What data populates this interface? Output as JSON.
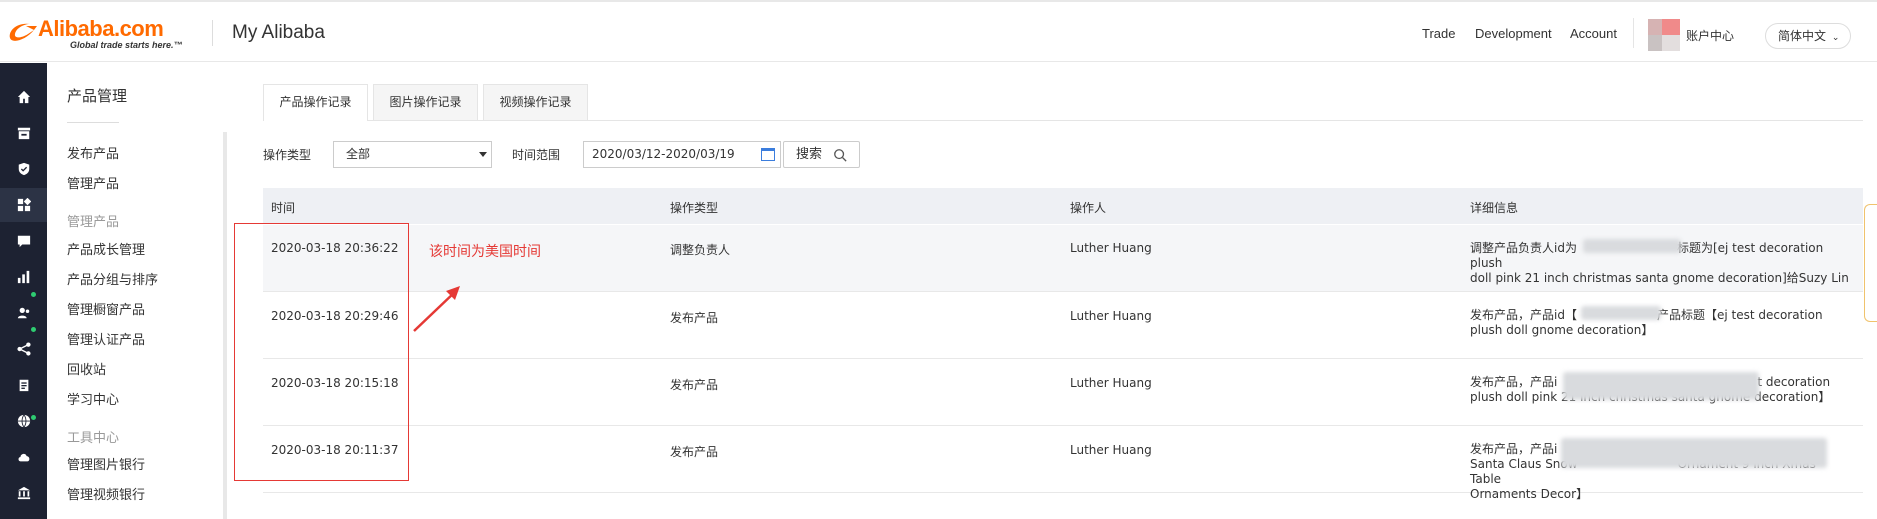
{
  "header": {
    "logo_text": "Alibaba.com",
    "logo_tagline": "Global trade starts here.™",
    "app_title": "My Alibaba",
    "nav": [
      "Trade",
      "Development",
      "Account"
    ],
    "account_center": "账户中心",
    "language": "简体中文"
  },
  "rail": {
    "icons": [
      "home-icon",
      "store-icon",
      "shield-icon",
      "apps-icon",
      "message-icon",
      "chart-icon",
      "users-icon",
      "share-icon",
      "clipboard-icon",
      "globe-icon",
      "cloud-icon",
      "bank-icon"
    ],
    "active": "apps-icon"
  },
  "side_menu": {
    "title": "产品管理",
    "items": [
      {
        "label": "发布产品",
        "type": "item"
      },
      {
        "label": "管理产品",
        "type": "item"
      },
      {
        "label": "管理产品",
        "type": "group"
      },
      {
        "label": "产品成长管理",
        "type": "item"
      },
      {
        "label": "产品分组与排序",
        "type": "item"
      },
      {
        "label": "管理橱窗产品",
        "type": "item"
      },
      {
        "label": "管理认证产品",
        "type": "item"
      },
      {
        "label": "回收站",
        "type": "item"
      },
      {
        "label": "学习中心",
        "type": "item"
      },
      {
        "label": "工具中心",
        "type": "group"
      },
      {
        "label": "管理图片银行",
        "type": "item"
      },
      {
        "label": "管理视频银行",
        "type": "item"
      }
    ]
  },
  "tabs": [
    {
      "label": "产品操作记录",
      "active": true
    },
    {
      "label": "图片操作记录",
      "active": false
    },
    {
      "label": "视频操作记录",
      "active": false
    }
  ],
  "filters": {
    "type_label": "操作类型",
    "type_value": "全部",
    "range_label": "时间范围",
    "range_value": "2020/03/12-2020/03/19",
    "search_label": "搜索"
  },
  "table": {
    "columns": [
      "时间",
      "操作类型",
      "操作人",
      "详细信息"
    ],
    "rows": [
      {
        "time": "2020-03-18 20:36:22",
        "type": "调整负责人",
        "operator": "Luther Huang",
        "detail_1": "调整产品负责人id为",
        "detail_1b": "标题为[ej test decoration plush",
        "detail_2": "doll pink 21 inch christmas santa gnome decoration]给Suzy Lin"
      },
      {
        "time": "2020-03-18 20:29:46",
        "type": "发布产品",
        "operator": "Luther Huang",
        "detail_1": "发布产品，产品id【",
        "detail_1b": "产品标题【ej test decoration",
        "detail_2": "plush doll gnome decoration】"
      },
      {
        "time": "2020-03-18 20:15:18",
        "type": "发布产品",
        "operator": "Luther Huang",
        "detail_1": "发布产品，产品i",
        "detail_1b": "t decoration",
        "detail_2": "plush doll pink 21 inch christmas santa gnome decoration】"
      },
      {
        "time": "2020-03-18 20:11:37",
        "type": "发布产品",
        "operator": "Luther Huang",
        "detail_1": "发布产品，产品i",
        "detail_1b": "",
        "detail_2": "Santa Claus Snow",
        "detail_2b": "Ornament 9 inch Xmas Table",
        "detail_3": "Ornaments Decor】"
      }
    ]
  },
  "annotation": {
    "text": "该时间为美国时间",
    "color": "#e53935"
  }
}
